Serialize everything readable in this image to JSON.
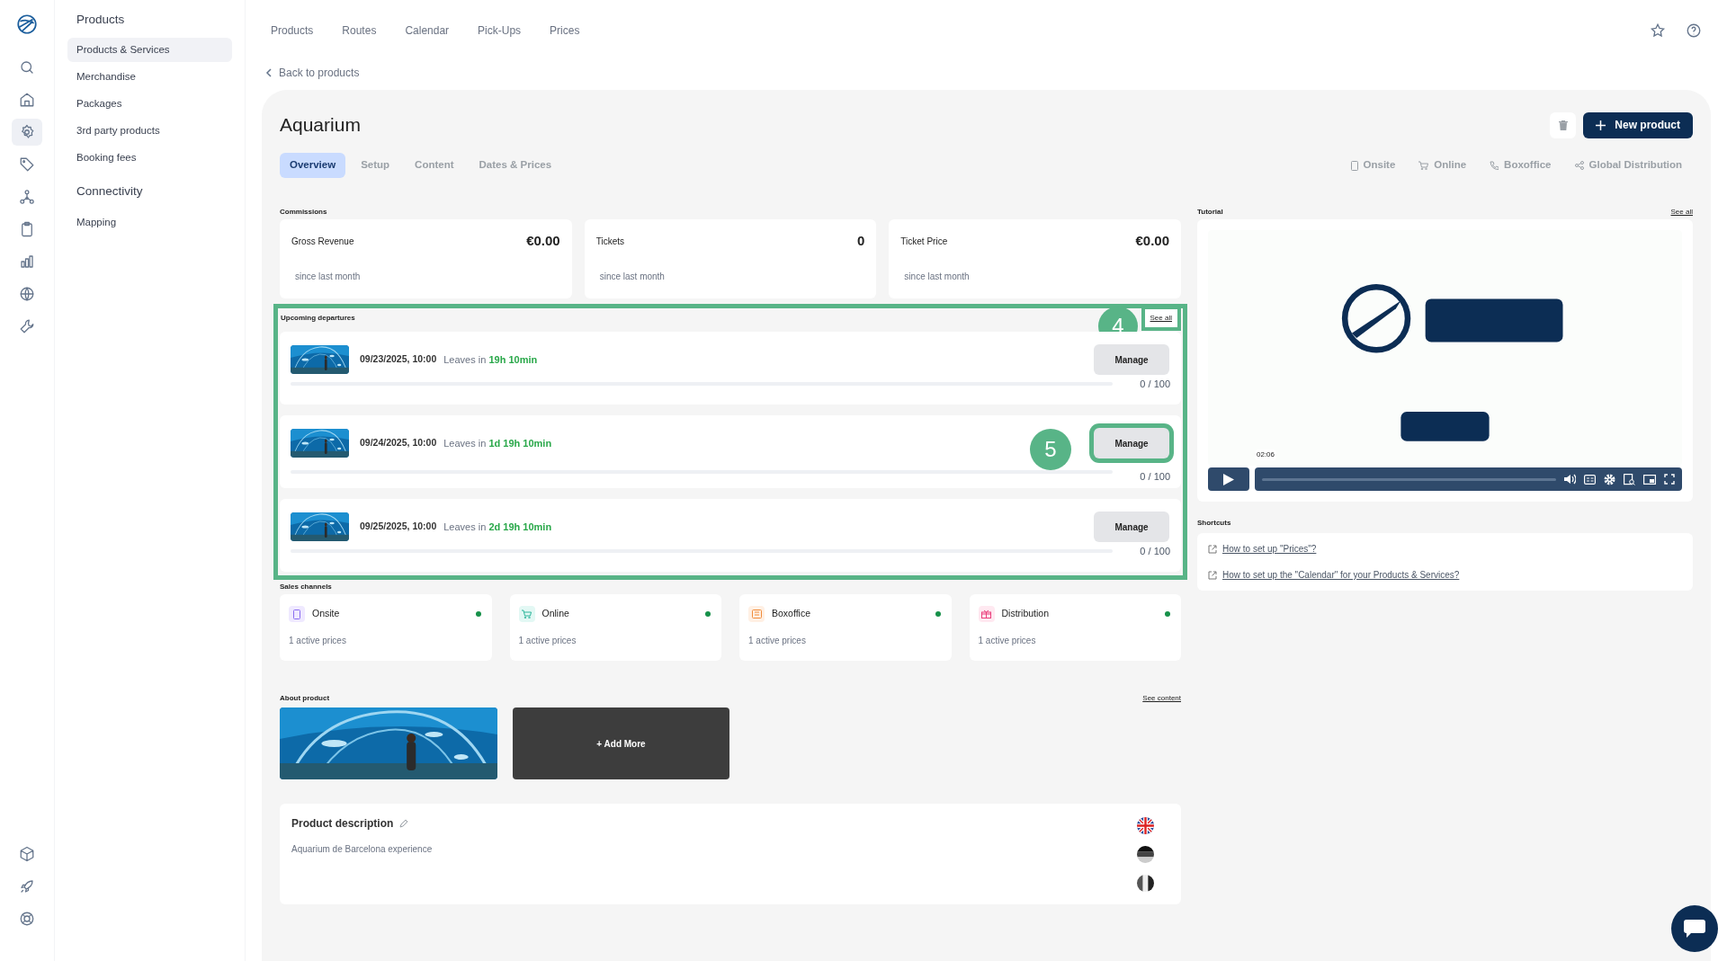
{
  "rail": [
    {
      "selected": false
    },
    {
      "selected": false
    },
    {
      "selected": false
    },
    {
      "selected": true
    },
    {
      "selected": false
    },
    {
      "selected": false
    },
    {
      "selected": false
    },
    {
      "selected": false
    },
    {
      "selected": false
    },
    {
      "selected": false
    },
    {
      "selected": false
    },
    {
      "selected": false
    },
    {
      "selected": false
    }
  ],
  "sidebar": [
    {
      "title": "Products",
      "items": [
        {
          "label": "Products & Services",
          "selected": true
        },
        {
          "label": "Merchandise",
          "selected": false
        },
        {
          "label": "Packages",
          "selected": false
        },
        {
          "label": "3rd party products",
          "selected": false
        },
        {
          "label": "Booking fees",
          "selected": false
        }
      ]
    },
    {
      "title": "Connectivity",
      "items": [
        {
          "label": "Mapping",
          "selected": false
        }
      ]
    }
  ],
  "top_nav": [
    "Products",
    "Routes",
    "Calendar",
    "Pick-Ups",
    "Prices"
  ],
  "back_link": "Back to products",
  "title": "Aquarium",
  "new_product": "New product",
  "tabs": [
    {
      "label": "Overview",
      "selected": true
    },
    {
      "label": "Setup",
      "selected": false
    },
    {
      "label": "Content",
      "selected": false
    },
    {
      "label": "Dates & Prices",
      "selected": false
    }
  ],
  "channel_filters": [
    "Onsite",
    "Online",
    "Boxoffice",
    "Global Distribution"
  ],
  "commissions": {
    "label": "Commissions",
    "cards": [
      {
        "label": "Gross Revenue",
        "value": "€0.00",
        "note": "since last month"
      },
      {
        "label": "Tickets",
        "value": "0",
        "note": "since last month"
      },
      {
        "label": "Ticket Price",
        "value": "€0.00",
        "note": "since last month"
      }
    ]
  },
  "departures": {
    "label": "Upcoming departures",
    "see_all": "See all",
    "callout": "4",
    "rows": [
      {
        "date": "09/23/2025, 10:00",
        "prefix": "Leaves in",
        "eta": "19h 10min",
        "button": "Manage",
        "capacity": "0 / 100",
        "level": 0,
        "callout": ""
      },
      {
        "date": "09/24/2025, 10:00",
        "prefix": "Leaves in",
        "eta": "1d 19h 10min",
        "button": "Manage",
        "capacity": "0 / 100",
        "level": 0,
        "callout": "5"
      },
      {
        "date": "09/25/2025, 10:00",
        "prefix": "Leaves in",
        "eta": "2d 19h 10min",
        "button": "Manage",
        "capacity": "0 / 100",
        "level": 0,
        "callout": ""
      }
    ]
  },
  "sales_channels": {
    "label": "Sales channels",
    "cards": [
      {
        "name": "Onsite",
        "note": "1 active prices",
        "active": true
      },
      {
        "name": "Online",
        "note": "1 active prices",
        "active": true
      },
      {
        "name": "Boxoffice",
        "note": "1 active prices",
        "active": true
      },
      {
        "name": "Distribution",
        "note": "1 active prices",
        "active": true
      }
    ]
  },
  "about": {
    "label": "About product",
    "link": "See content",
    "add_more": "+ Add More"
  },
  "description": {
    "title": "Product description",
    "text": "Aquarium de Barcelona experience"
  },
  "tutorial": {
    "label": "Tutorial",
    "see_all": "See all",
    "time": "02:06"
  },
  "shortcuts": {
    "label": "Shortcuts",
    "links": [
      "How to set up \"Prices\"?",
      "How to set up the \"Calendar\" for your Products & Services?"
    ]
  }
}
